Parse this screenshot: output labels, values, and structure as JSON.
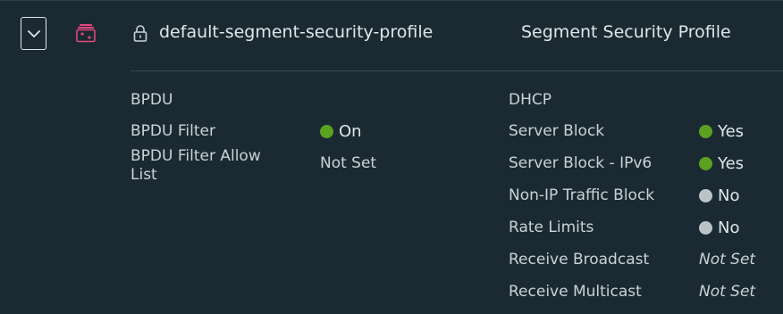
{
  "header": {
    "profile_name": "default-segment-security-profile",
    "profile_type": "Segment Security Profile",
    "icons": {
      "expand": "chevron-down-icon",
      "type": "segment-profile-icon",
      "lock": "lock-icon"
    }
  },
  "bpdu": {
    "title": "BPDU",
    "rows": [
      {
        "label": "BPDU Filter",
        "value": "On",
        "status": "green"
      },
      {
        "label": "BPDU Filter Allow List",
        "value": "Not Set",
        "status": "none"
      }
    ]
  },
  "dhcp": {
    "title": "DHCP",
    "rows": [
      {
        "label": "Server Block",
        "value": "Yes",
        "status": "green"
      },
      {
        "label": "Server Block - IPv6",
        "value": "Yes",
        "status": "green"
      },
      {
        "label": "Non-IP Traffic Block",
        "value": "No",
        "status": "gray"
      },
      {
        "label": "Rate Limits",
        "value": "No",
        "status": "gray"
      },
      {
        "label": "Receive Broadcast",
        "value": "Not Set",
        "status": "italic"
      },
      {
        "label": "Receive Multicast",
        "value": "Not Set",
        "status": "italic"
      }
    ]
  },
  "colors": {
    "background": "#1b2a32",
    "status_green": "#5aa220",
    "status_gray": "#b9c3c8",
    "icon_accent": "#e0467c"
  }
}
